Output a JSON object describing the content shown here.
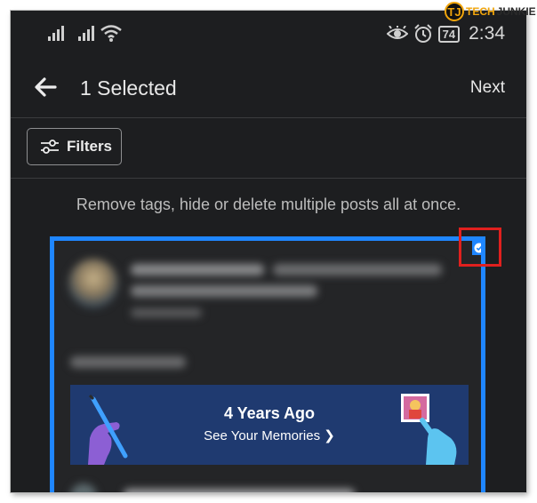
{
  "status_bar": {
    "battery": "74",
    "time": "2:34"
  },
  "header": {
    "title": "1 Selected",
    "next_label": "Next"
  },
  "filters": {
    "label": "Filters"
  },
  "hint": "Remove tags, hide or delete multiple posts all at once.",
  "post": {
    "selected": true,
    "memory_card": {
      "title": "4 Years Ago",
      "subtitle": "See Your Memories ❯"
    }
  },
  "watermark": {
    "tech": "TECH",
    "junkie": "JUNKIE",
    "badge": "TJ"
  },
  "colors": {
    "background": "#1d1e20",
    "selection_border": "#1f86ff",
    "annotation": "#e0201e",
    "memory_card": "#1f3a70"
  }
}
